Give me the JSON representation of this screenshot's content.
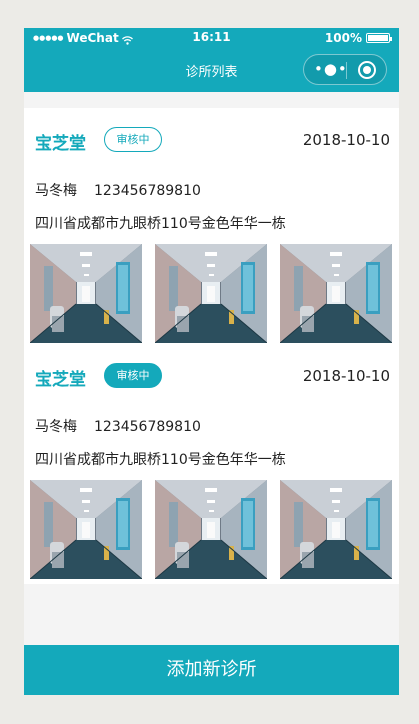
{
  "status_bar": {
    "carrier": "WeChat",
    "time": "16:11",
    "battery": "100%"
  },
  "nav": {
    "title": "诊所列表",
    "more_icon": "ellipsis-icon",
    "close_icon": "target-icon"
  },
  "clinics": [
    {
      "name": "宝芝堂",
      "status": "审核中",
      "status_style": "outline",
      "date": "2018-10-10",
      "contact_name": "马冬梅",
      "phone": "123456789810",
      "address": "四川省成都市九眼桥110号金色年华一栋"
    },
    {
      "name": "宝芝堂",
      "status": "审核中",
      "status_style": "filled",
      "date": "2018-10-10",
      "contact_name": "马冬梅",
      "phone": "123456789810",
      "address": "四川省成都市九眼桥110号金色年华一栋"
    }
  ],
  "footer": {
    "add_label": "添加新诊所"
  },
  "colors": {
    "accent": "#14a9bb"
  }
}
